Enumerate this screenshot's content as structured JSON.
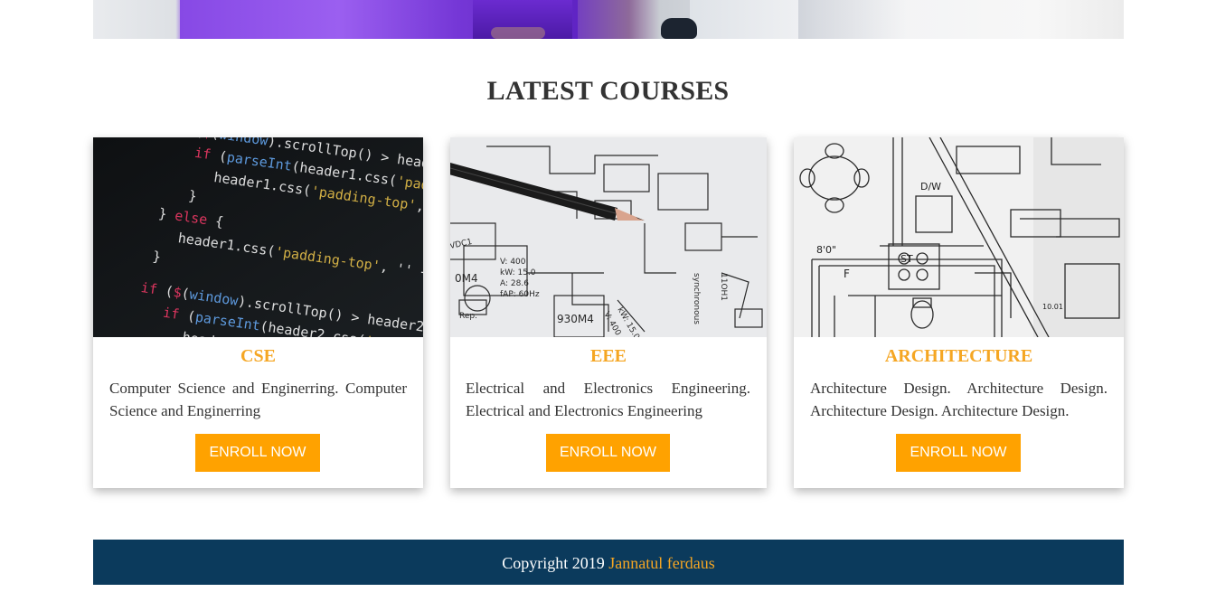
{
  "section": {
    "title": "LATEST COURSES"
  },
  "courses": [
    {
      "title": "CSE",
      "description": "Computer Science and Enginerring. Computer Science and Enginerring",
      "button_label": "ENROLL NOW",
      "image": "code-screen-photo"
    },
    {
      "title": "EEE",
      "description": "Electrical and Electronics Engineering. Electrical and Electronics Engineering",
      "button_label": "ENROLL NOW",
      "image": "circuit-schematic-pencil-photo"
    },
    {
      "title": "ARCHITECTURE",
      "description": "Architecture Design. Architecture Design. Architecture Design. Architecture Design.",
      "button_label": "ENROLL NOW",
      "image": "floor-plan-blueprint-photo"
    }
  ],
  "footer": {
    "copyright": "Copyright 2019",
    "author": "Jannatul ferdaus"
  },
  "colors": {
    "accent": "#ffa200",
    "title_accent": "#f5a623",
    "footer_bg": "#0b3a5c",
    "text": "#333333"
  }
}
